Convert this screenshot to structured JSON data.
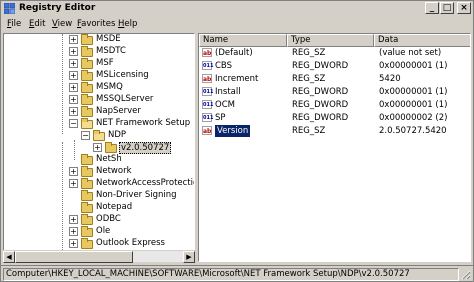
{
  "window": {
    "title": "Registry Editor",
    "controls": {
      "minimize": "_",
      "maximize": "□",
      "close": "×"
    }
  },
  "menu": [
    {
      "label": "File",
      "ul": "F",
      "rest": "ile"
    },
    {
      "label": "Edit",
      "ul": "E",
      "rest": "dit"
    },
    {
      "label": "View",
      "ul": "V",
      "rest": "iew"
    },
    {
      "label": "Favorites",
      "ul": "F",
      "rest": "avorites",
      "prefix": ""
    },
    {
      "label": "Help",
      "ul": "H",
      "rest": "elp"
    }
  ],
  "tree": {
    "items": [
      {
        "label": "MSDE",
        "expander": "+"
      },
      {
        "label": "MSDTC",
        "expander": "+"
      },
      {
        "label": "MSF",
        "expander": "+"
      },
      {
        "label": "MSLicensing",
        "expander": "+"
      },
      {
        "label": "MSMQ",
        "expander": "+"
      },
      {
        "label": "MSSQLServer",
        "expander": "+"
      },
      {
        "label": "NapServer",
        "expander": "+"
      },
      {
        "label": "NET Framework Setup",
        "expander": "−"
      },
      {
        "label": "NDP",
        "expander": "−"
      },
      {
        "label": "v2.0.50727",
        "expander": "+",
        "selected": true
      },
      {
        "label": "NetSh",
        "expander": ""
      },
      {
        "label": "Network",
        "expander": "+"
      },
      {
        "label": "NetworkAccessProtection",
        "expander": "+"
      },
      {
        "label": "Non-Driver Signing",
        "expander": ""
      },
      {
        "label": "Notepad",
        "expander": ""
      },
      {
        "label": "ODBC",
        "expander": "+"
      },
      {
        "label": "Ole",
        "expander": "+"
      },
      {
        "label": "Outlook Express",
        "expander": "+"
      }
    ]
  },
  "values": {
    "columns": {
      "name": "Name",
      "type": "Type",
      "data": "Data"
    },
    "rows": [
      {
        "icon": "string-value-icon",
        "glyph": "ab",
        "name": "(Default)",
        "type": "REG_SZ",
        "data": "(value not set)"
      },
      {
        "icon": "dword-value-icon",
        "glyph": "011",
        "name": "CBS",
        "type": "REG_DWORD",
        "data": "0x00000001 (1)"
      },
      {
        "icon": "string-value-icon",
        "glyph": "ab",
        "name": "Increment",
        "type": "REG_SZ",
        "data": "5420"
      },
      {
        "icon": "dword-value-icon",
        "glyph": "011",
        "name": "Install",
        "type": "REG_DWORD",
        "data": "0x00000001 (1)"
      },
      {
        "icon": "dword-value-icon",
        "glyph": "011",
        "name": "OCM",
        "type": "REG_DWORD",
        "data": "0x00000001 (1)"
      },
      {
        "icon": "dword-value-icon",
        "glyph": "011",
        "name": "SP",
        "type": "REG_DWORD",
        "data": "0x00000002 (2)"
      },
      {
        "icon": "string-value-icon",
        "glyph": "ab",
        "name": "Version",
        "type": "REG_SZ",
        "data": "2.0.50727.5420",
        "selected": true
      }
    ]
  },
  "status": {
    "path": "Computer\\HKEY_LOCAL_MACHINE\\SOFTWARE\\Microsoft\\NET Framework Setup\\NDP\\v2.0.50727"
  },
  "colors": {
    "chrome": "#d4d0c8",
    "selection": "#0a246a",
    "folder": "#e8c860"
  }
}
